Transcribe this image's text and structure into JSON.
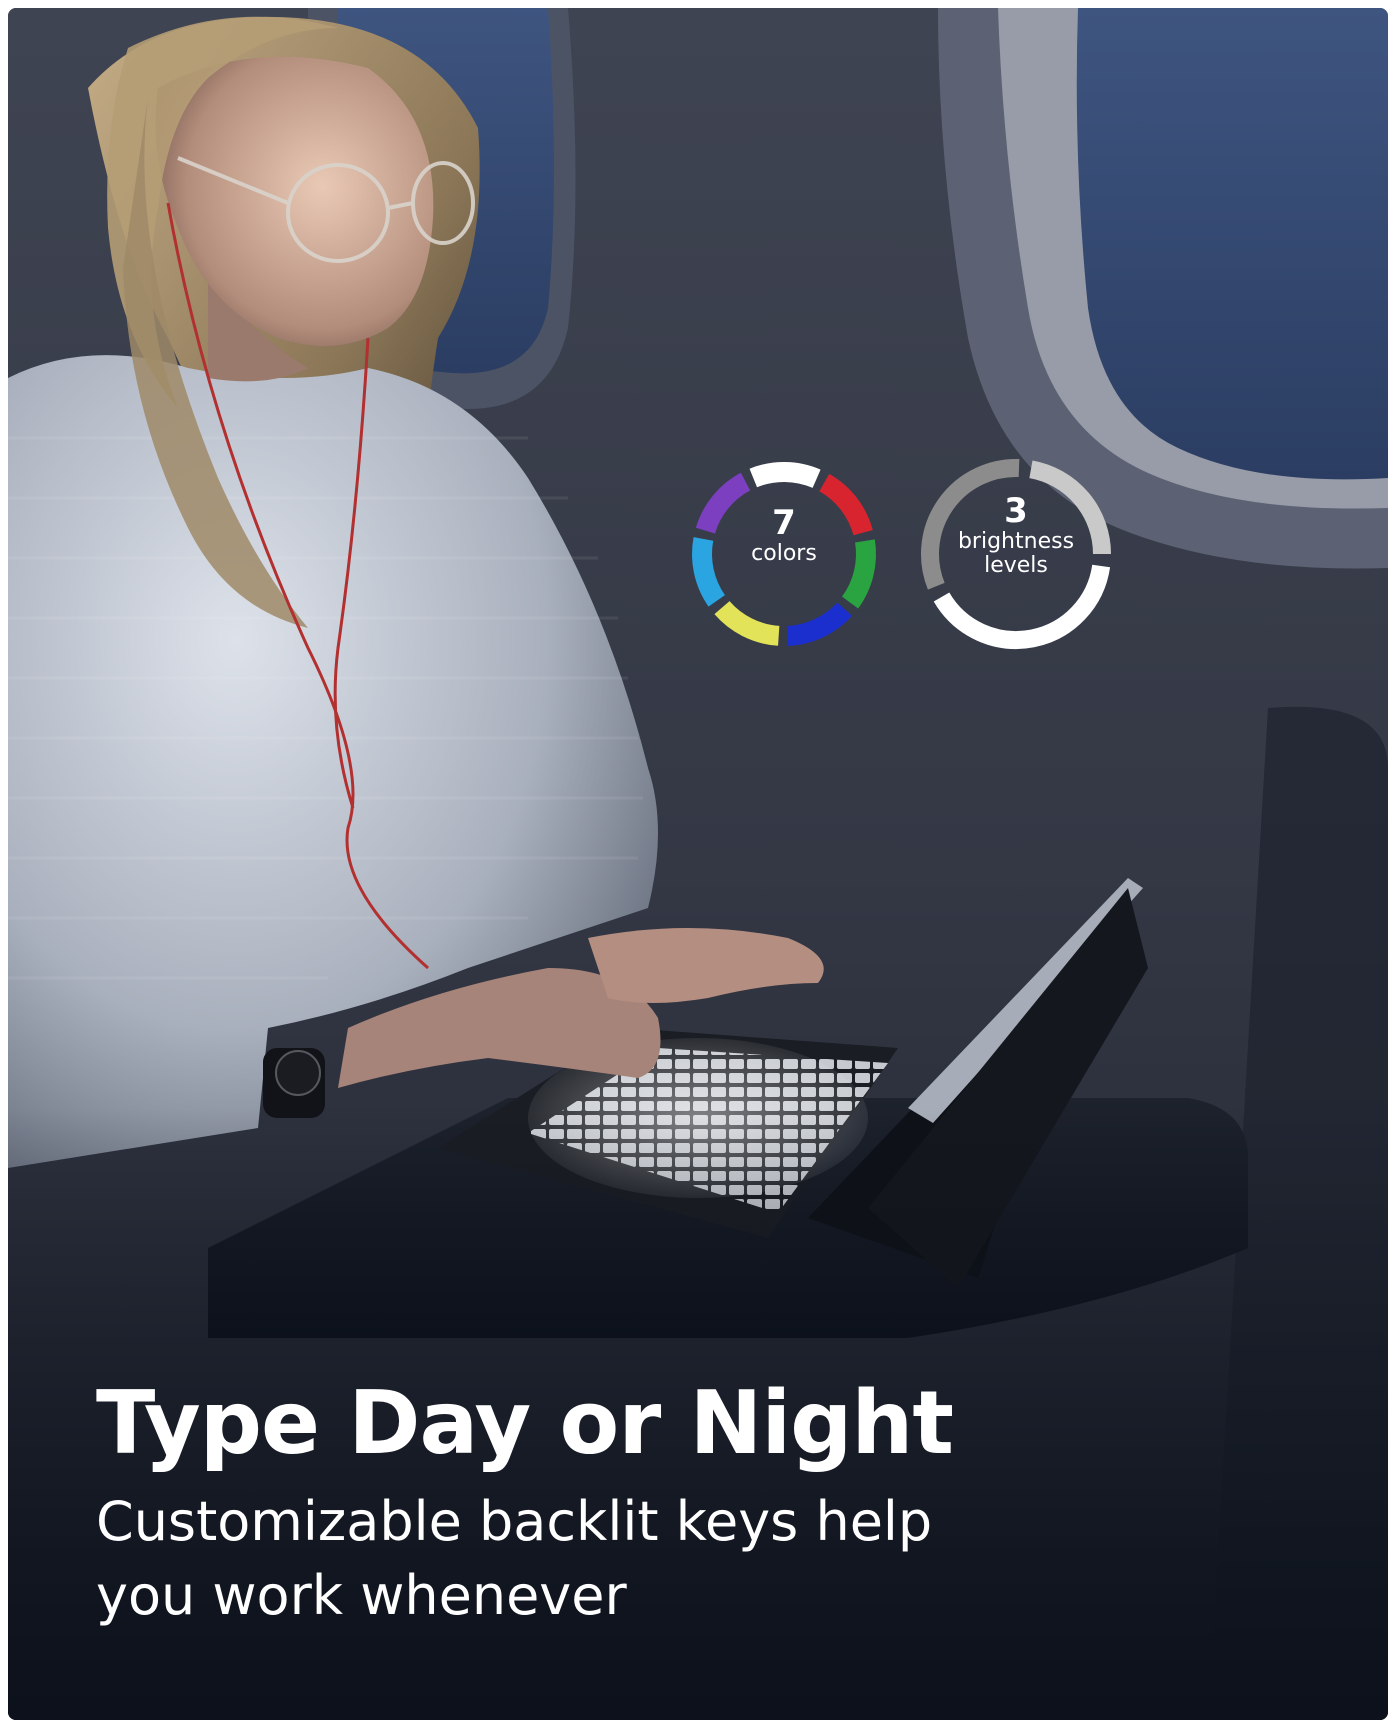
{
  "headline": "Type Day or Night",
  "subline": "Customizable backlit keys help you work whenever",
  "badges": {
    "colors": {
      "value": "7",
      "label": "colors",
      "segment_colors": [
        "#ffffff",
        "#d8242f",
        "#2aa341",
        "#1b2fcf",
        "#e3e35a",
        "#2ba4e2",
        "#7c3fbf"
      ]
    },
    "brightness": {
      "value": "3",
      "label": "brightness levels",
      "segment_colors": [
        "#c9c9c9",
        "#ffffff",
        "#8c8c8c"
      ]
    }
  },
  "colors": {
    "background": "#151a26",
    "text": "#ffffff"
  }
}
